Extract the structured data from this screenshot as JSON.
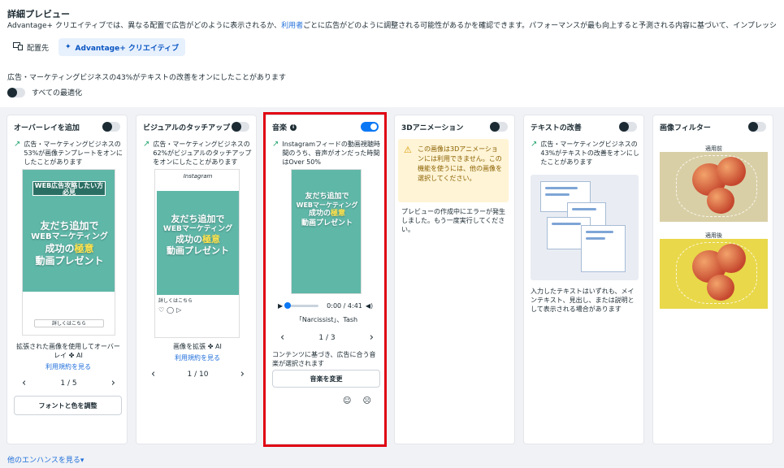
{
  "header": {
    "title": "詳細プレビュー",
    "desc_pre": "Advantage+ クリエイティブでは、異なる配置で広告がどのように表示されるか、",
    "desc_link": "利用者",
    "desc_post": "ごとに広告がどのように調整される可能性があるかを確認できます。パフォーマンスが最も向上すると予測される内容に基づいて、インプレッシ",
    "tab_placement": "配置先",
    "tab_creative": "Advantage+ クリエイティブ",
    "stat_line": "広告・マーケティングビジネスの43%がテキストの改善をオンにしたことがあります",
    "optimize_all": "すべての最適化"
  },
  "cards": {
    "overlay": {
      "title": "オーバーレイを追加",
      "stat": "広告・マーケティングビジネスの53%が画像テンプレートをオンにしたことがあります",
      "banner": "WEB広告攻略したい方必見",
      "line1": "友だち追加で",
      "line2": "WEBマーケティング",
      "line3a": "成功の",
      "line3b": "極意",
      "line4": "動画プレゼント",
      "cta": "詳しくはこちら",
      "caption": "拡張された画像を使用してオーバーレイ",
      "ai": "AI",
      "terms": "利用規約を見る",
      "pager": "1 / 5",
      "adjust_btn": "フォントと色を調整"
    },
    "touchup": {
      "title": "ビジュアルのタッチアップ",
      "stat": "広告・マーケティングビジネスの62%がビジュアルのタッチアップをオンにしたことがあります",
      "ig": "Instagram",
      "line1": "友だち追加で",
      "line2": "WEBマーケティング",
      "line3a": "成功の",
      "line3b": "極意",
      "line4": "動画プレゼント",
      "cta": "詳しくはこちら",
      "caption": "画像を拡張",
      "ai": "AI",
      "terms": "利用規約を見る",
      "pager": "1 / 10"
    },
    "music": {
      "title": "音楽",
      "stat": "Instagramフィードの動画視聴時間のうち、音声がオンだった時間はOver 50%",
      "line1": "友だち追加で",
      "line2": "WEBマーケティング",
      "line3a": "成功の",
      "line3b": "極意",
      "line4": "動画プレゼント",
      "time": "0:00 / 4:41",
      "track": "「Narcissist」、Tash",
      "pager": "1 / 3",
      "desc": "コンテンツに基づき、広告に合う音楽が選択されます",
      "change_btn": "音楽を変更"
    },
    "anim3d": {
      "title": "3Dアニメーション",
      "warning": "この画像は3Dアニメーションには利用できません。この機能を使うには、他の画像を選択してください。",
      "error": "プレビューの作成中にエラーが発生しました。もう一度実行してください。"
    },
    "text": {
      "title": "テキストの改善",
      "stat": "広告・マーケティングビジネスの43%がテキストの改善をオンにしたことがあります",
      "desc": "入力したテキストはいずれも、メインテキスト、見出し、または説明として表示される場合があります"
    },
    "filter": {
      "title": "画像フィルター",
      "before": "適用前",
      "after": "適用後"
    }
  },
  "footer": {
    "more": "他のエンハンスを見る▾"
  },
  "colors": {
    "accent": "#0a78f5",
    "highlight_box": "#e00012",
    "teal": "#5fb7a8"
  }
}
